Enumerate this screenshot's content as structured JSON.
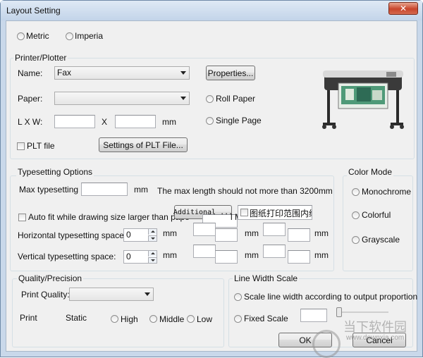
{
  "window": {
    "title": "Layout Setting",
    "close_symbol": "✕"
  },
  "units": {
    "metric": "Metric",
    "imperial": "Imperia"
  },
  "printer": {
    "group_title": "Printer/Plotter",
    "name_label": "Name:",
    "name_value": "Fax",
    "properties_button": "Properties...",
    "paper_label": "Paper:",
    "paper_value": "",
    "roll_paper": "Roll Paper",
    "single_page": "Single Page",
    "lxw_label": "L X W:",
    "x_label": "X",
    "mm_label": "mm",
    "plt_file": "PLT file",
    "plt_settings_button": "Settings of PLT File..."
  },
  "typesetting": {
    "group_title": "Typesetting Options",
    "max_label": "Max typesetting",
    "max_unit": "mm",
    "max_note": "The max length should not more than 3200mm",
    "autofit_label": "Auto fit while drawing size larger than pape",
    "additional_button": "Additional ...",
    "chinese_check": "图纸打印范围内缩",
    "partial_text": "l Ma",
    "horizontal_label": "Horizontal typesetting space:",
    "horizontal_value": "0",
    "vertical_label": "Vertical typesetting space:",
    "vertical_value": "0",
    "mm": "mm"
  },
  "color_mode": {
    "group_title": "Color Mode",
    "options": [
      "Monochrome",
      "Colorful",
      "Grayscale"
    ]
  },
  "quality": {
    "group_title": "Quality/Precision",
    "print_quality_label": "Print Quality:",
    "print_quality_value": "",
    "print_label": "Print",
    "static_label": "Static",
    "options": [
      "High",
      "Middle",
      "Low"
    ]
  },
  "line_width": {
    "group_title": "Line Width Scale",
    "proportion_label": "Scale line width according to output proportion",
    "fixed_label": "Fixed Scale"
  },
  "footer": {
    "ok": "OK",
    "cancel": "Cancel"
  },
  "watermark": {
    "text": "当下软件园",
    "url": "www.downxia.com"
  }
}
